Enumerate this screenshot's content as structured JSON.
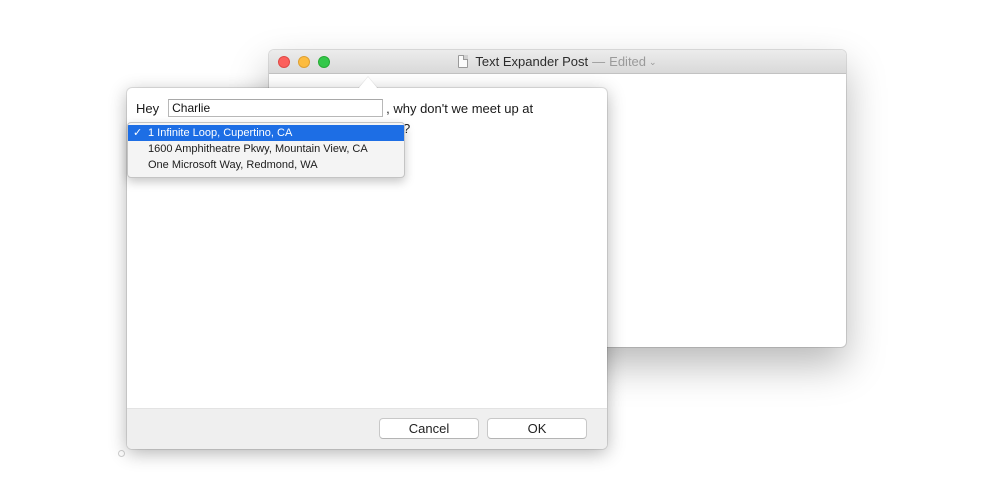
{
  "document_window": {
    "title": "Text Expander Post",
    "separator": "—",
    "edited_label": "Edited",
    "chevron": "⌄",
    "icon": "document-icon"
  },
  "popover": {
    "greeting": "Hey",
    "name_input": {
      "value": "Charlie",
      "placeholder": ""
    },
    "sentence_rest": ", why don't we meet up at",
    "sentence_end": "?",
    "dropdown": {
      "items": [
        {
          "label": "1 Infinite Loop, Cupertino, CA",
          "selected": true,
          "check": "✓"
        },
        {
          "label": "1600 Amphitheatre Pkwy, Mountain View, CA",
          "selected": false,
          "check": ""
        },
        {
          "label": "One Microsoft Way, Redmond, WA",
          "selected": false,
          "check": ""
        }
      ]
    },
    "buttons": {
      "cancel": "Cancel",
      "ok": "OK"
    }
  },
  "colors": {
    "selection_blue": "#1d6ee5",
    "close_red": "#fc605c",
    "minimize_yellow": "#fdbc40",
    "zoom_green": "#34c84a"
  }
}
